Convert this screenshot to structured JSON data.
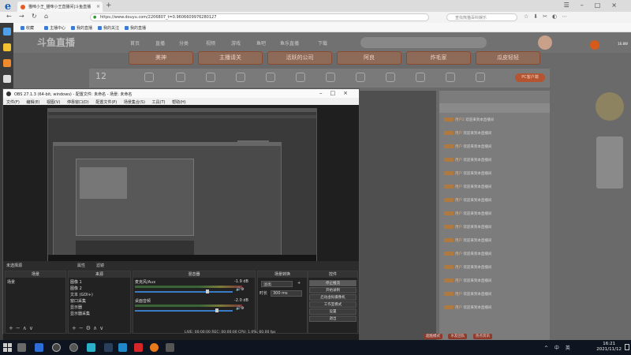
{
  "browser": {
    "logo": "e",
    "tab_title": "猫咪小王_猫咪小王直播间|斗鱼直播",
    "url": "https://www.douyu.com/2206807_t=0.9606609976280127",
    "search_placeholder": "查找熊猫百科娱乐",
    "bookmarks": [
      "收藏",
      "主播中心",
      "我的直播",
      "我的关注",
      "我的直播"
    ]
  },
  "douyu": {
    "logo": "斗鱼直播",
    "nav": [
      "首页",
      "直播",
      "分类",
      "视频",
      "游戏",
      "鱼吧",
      "鱼乐直播",
      "下载"
    ],
    "pill_buttons": [
      "美神",
      "主播请关",
      "活跃的公司",
      "阿良",
      "炸毛家",
      "瓜皮轻轻"
    ],
    "counter": "12",
    "pc_button": "PC客户端",
    "stat": "16.8W",
    "chat_rows": [
      {
        "name": "用户2",
        "text": "欢迎来到本直播间"
      },
      {
        "name": "用户",
        "text": "欢迎来到本直播间"
      },
      {
        "name": "用户",
        "text": "欢迎来到本直播间"
      },
      {
        "name": "用户",
        "text": "欢迎来到本直播间"
      },
      {
        "name": "用户",
        "text": "欢迎来到本直播间"
      },
      {
        "name": "用户",
        "text": "欢迎来到本直播间"
      },
      {
        "name": "用户",
        "text": "欢迎来到本直播间"
      },
      {
        "name": "用户",
        "text": "欢迎来到本直播间"
      },
      {
        "name": "用户",
        "text": "欢迎来到本直播间"
      },
      {
        "name": "用户",
        "text": "欢迎来到本直播间"
      },
      {
        "name": "用户",
        "text": "欢迎来到本直播间"
      },
      {
        "name": "用户",
        "text": "欢迎来到本直播间"
      },
      {
        "name": "用户",
        "text": "欢迎来到本直播间"
      },
      {
        "name": "用户",
        "text": "欢迎来到本直播间"
      },
      {
        "name": "用户",
        "text": "欢迎来到本直播间"
      }
    ],
    "bottom_links": [
      "超酷模式",
      "水友团队",
      "热点资讯"
    ]
  },
  "obs": {
    "title": "OBS 27.1.3 (64-bit, windows) - 配置文件: 未命名 - 场景: 未命名",
    "menu": [
      "文件(F)",
      "编辑(E)",
      "视图(V)",
      "停靠窗口(D)",
      "配置文件(P)",
      "场景集合(S)",
      "工具(T)",
      "帮助(H)"
    ],
    "scene_label": "未选择源",
    "props_btn": "属性",
    "filters_btn": "滤镜",
    "docks": {
      "scenes": "场景",
      "sources": "来源",
      "mixer": "混音器",
      "transitions": "场景转换",
      "controls": "控件"
    },
    "scene_items": [
      "场景"
    ],
    "source_items": [
      "图像 1",
      "图像 2",
      "文本 (GDI+)",
      "窗口采集",
      "显示器",
      "显示器采集"
    ],
    "mixer_items": [
      {
        "name": "麦克风/Aux",
        "db": "-1.9 dB"
      },
      {
        "name": "桌面音频",
        "db": "-2.0 dB"
      }
    ],
    "transition": "淡出",
    "duration_label": "时长",
    "duration_value": "300 ms",
    "controls": [
      "停止推流",
      "开始录制",
      "启动虚拟摄像机",
      "工作室模式",
      "设置",
      "退出"
    ],
    "status": "LIVE: 00:00:00    REC: 00:00:00    CPU: 1.0%, 60.00 fps"
  },
  "taskbar": {
    "tray": "^ 中 英",
    "time": "16:21",
    "date": "2021/11/12"
  }
}
